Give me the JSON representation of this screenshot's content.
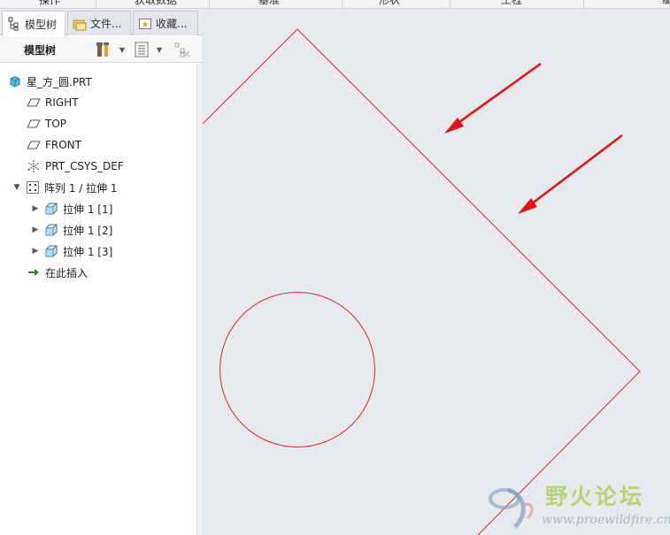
{
  "ribbon": {
    "labels": [
      "操作",
      "获取数据",
      "基准",
      "形状",
      "工程",
      "编"
    ]
  },
  "tabs": [
    {
      "label": "模型树",
      "icon": "model-tree-icon"
    },
    {
      "label": "文件...",
      "icon": "folder-icon"
    },
    {
      "label": "收藏...",
      "icon": "favorites-icon"
    }
  ],
  "toolbar": {
    "title": "模型树"
  },
  "tree": {
    "root": {
      "label": "星_方_圆.PRT",
      "icon": "part-icon"
    },
    "datums": [
      {
        "label": "RIGHT",
        "icon": "datum-plane-icon"
      },
      {
        "label": "TOP",
        "icon": "datum-plane-icon"
      },
      {
        "label": "FRONT",
        "icon": "datum-plane-icon"
      },
      {
        "label": "PRT_CSYS_DEF",
        "icon": "csys-icon"
      }
    ],
    "pattern": {
      "label": "阵列 1 / 拉伸 1",
      "icon": "pattern-icon",
      "expanded": true
    },
    "members": [
      {
        "label": "拉伸 1 [1]",
        "icon": "extrude-icon"
      },
      {
        "label": "拉伸 1 [2]",
        "icon": "extrude-icon"
      },
      {
        "label": "拉伸 1 [3]",
        "icon": "extrude-icon"
      }
    ],
    "insert_here": {
      "label": "在此插入",
      "icon": "insert-arrow-icon"
    }
  },
  "graphics": {
    "line_color": "#d42b2b",
    "arrow_color": "#e01414",
    "background": "#e6e9ed"
  },
  "watermark": {
    "title": "野火论坛",
    "url": "www.proewildfire.cn"
  }
}
